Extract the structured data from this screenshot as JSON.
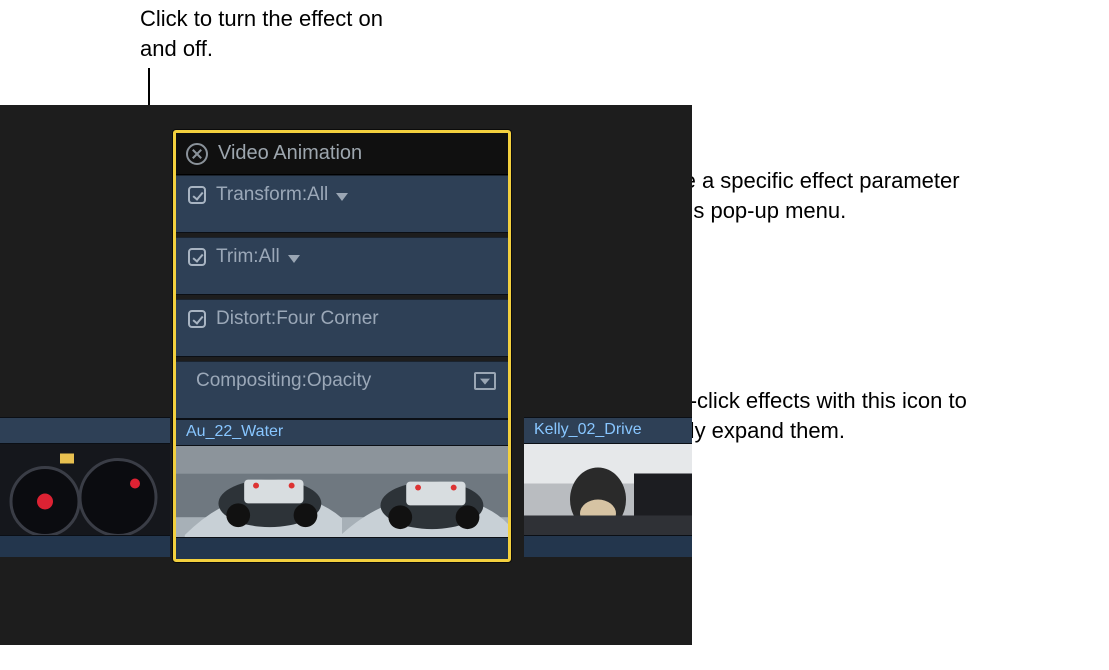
{
  "callouts": {
    "top": "Click to turn the effect on and off.",
    "right1": "Choose a specific effect parameter from this pop-up menu.",
    "right2": "Double-click effects with this icon to vertically expand them."
  },
  "panel": {
    "title": "Video Animation",
    "effects": [
      {
        "name": "Transform",
        "param": "All",
        "hasDropdown": true,
        "hasExpand": false
      },
      {
        "name": "Trim",
        "param": "All",
        "hasDropdown": true,
        "hasExpand": false
      },
      {
        "name": "Distort",
        "param": "Four Corner",
        "hasDropdown": false,
        "hasExpand": false
      },
      {
        "name": "Compositing",
        "param": "Opacity",
        "hasDropdown": false,
        "hasExpand": true,
        "noCheck": true
      }
    ],
    "clip_name": "Au_22_Water"
  },
  "right_clip_name": "Kelly_02_Drive"
}
